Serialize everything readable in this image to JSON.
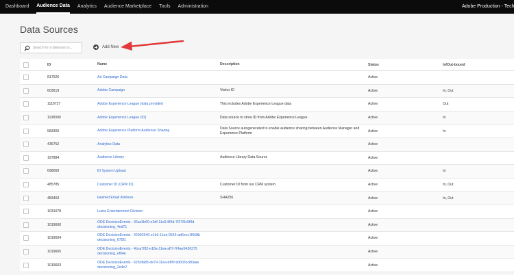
{
  "nav": {
    "items": [
      {
        "label": "Dashboard",
        "active": false
      },
      {
        "label": "Audience Data",
        "active": true
      },
      {
        "label": "Analytics",
        "active": false
      },
      {
        "label": "Audience Marketplace",
        "active": false
      },
      {
        "label": "Tools",
        "active": false
      },
      {
        "label": "Administration",
        "active": false
      }
    ],
    "org": "Adobe Production - Tech Ma"
  },
  "page": {
    "title": "Data Sources",
    "search_placeholder": "Search for a datasource...",
    "add_new_label": "Add New"
  },
  "table": {
    "headers": {
      "id": "ID",
      "name": "Name",
      "description": "Description",
      "status": "Status",
      "inout": "In/Out-bound"
    },
    "rows": [
      {
        "id": "817526",
        "name": "Ad Campaign Data",
        "description": "",
        "status": "Active",
        "inout": ""
      },
      {
        "id": "603619",
        "name": "Adobe Campaign",
        "description": "Visitor ID",
        "status": "Active",
        "inout": "In, Out"
      },
      {
        "id": "1118727",
        "name": "Adobe Experience League (data provider)",
        "description": "This includes Adobe Experience League data",
        "status": "Active",
        "inout": "Out"
      },
      {
        "id": "1108390",
        "name": "Adobe Experience League (ID)",
        "description": "Data source to store ID from Adobe Experience League",
        "status": "Active",
        "inout": "In"
      },
      {
        "id": "583300",
        "name": "Adobe Experience Platform Audience Sharing",
        "description": "Data Source autogenerated to enable audience sharing between Audience Manager and Experience Platform",
        "status": "Active",
        "inout": "In"
      },
      {
        "id": "436752",
        "name": "Analytics Data",
        "description": "",
        "status": "Active",
        "inout": ""
      },
      {
        "id": "197884",
        "name": "Audience Library",
        "description": "Audience Library Data Source",
        "status": "Active",
        "inout": ""
      },
      {
        "id": "698069",
        "name": "BI System Upload",
        "description": "",
        "status": "Active",
        "inout": "In"
      },
      {
        "id": "485785",
        "name": "Customer ID (CRM ID)",
        "description": "Customer ID from our CRM system",
        "status": "Active",
        "inout": "In, Out"
      },
      {
        "id": "483403",
        "name": "Hashed Email Address",
        "description": "SHA256",
        "status": "Active",
        "inout": "In, Out"
      },
      {
        "id": "1031078",
        "name": "Luma Entertainment Division",
        "description": "",
        "status": "Active",
        "inout": ""
      },
      {
        "id": "1019600",
        "name": "ODE DecisionEvents - 36ac3b60-e3df-11e9-8f5d-7f27f6c5f0d decisioning_4ed71",
        "description": "",
        "status": "Active",
        "inout": ""
      },
      {
        "id": "1019604",
        "name": "ODE DecisionEvents - 42992540-e1b3-11ea-9643-ad6ecc1f668b decisioning_675f1",
        "description": "",
        "status": "Active",
        "inout": ""
      },
      {
        "id": "1019605",
        "name": "ODE DecisionEvents - 4bca7f82-e18a-11ea-aff7-f74ae5436375 decisioning_ef04e",
        "description": "",
        "status": "Active",
        "inout": ""
      },
      {
        "id": "1019603",
        "name": "ODE DecisionEvents - 6263fa85-de79-11ea-b8f0-9d003cc80aae decisioning_2e4e2",
        "description": "",
        "status": "Active",
        "inout": ""
      }
    ]
  },
  "colors": {
    "nav_bg": "#0b0b0b",
    "link": "#2c6bd1",
    "arrow": "#e03a3a"
  }
}
